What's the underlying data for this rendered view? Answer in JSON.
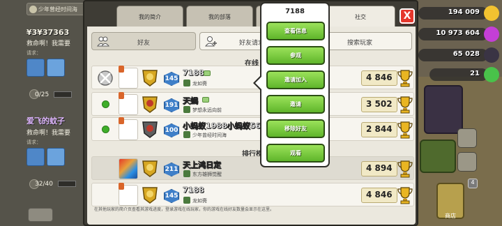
{
  "chat": {
    "clan_label": "少年曾经时间海",
    "messages": [
      {
        "name": "¥3¥37363",
        "text": "救命啊！我需要",
        "sub": "请求：",
        "progress": "0/25"
      },
      {
        "name": "爱飞的蚊子",
        "text": "救命啊！我需要",
        "sub": "请求：",
        "progress": "32/40"
      }
    ]
  },
  "resources": {
    "gold": "194 009",
    "elixir": "10 973 604",
    "dark": "65 028",
    "gems": "21"
  },
  "tabs": [
    {
      "label": "我的简介"
    },
    {
      "label": "我的部落"
    },
    {
      "label": ""
    },
    {
      "label": "社交"
    }
  ],
  "close_label": "X",
  "subtabs": {
    "friends": "好友",
    "add_friend": "好友请求",
    "search": "搜索玩家"
  },
  "sections": {
    "online": "在线",
    "leaderboard": "排行榜"
  },
  "friends": [
    {
      "name": "7188",
      "clan": "龙如斋",
      "level": "145",
      "trophies": "4 846",
      "league_rank": "1"
    },
    {
      "name": "天蝎",
      "clan": "梦想永远向前",
      "level": "191",
      "trophies": "3 502",
      "league_rank": "2"
    },
    {
      "name": "小蚂蚁1988小蚂蚁5612",
      "clan": "少年曾经时间海",
      "level": "100",
      "trophies": "2 844",
      "league_rank": "2"
    },
    {
      "name": "天上鸿日定",
      "clan": "东方雄狮觉醒",
      "level": "211",
      "trophies": "4 894",
      "league_rank": ""
    },
    {
      "name": "7188",
      "clan": "龙如斋",
      "level": "145",
      "trophies": "4 846",
      "league_rank": "1"
    }
  ],
  "footnote": "在其他玩家的简介页查看其游戏进度，登录游戏在线玩家，你的游戏在线好友数量会显示在这里。",
  "popup": {
    "title": "7188",
    "items": [
      "查看信息",
      "参观",
      "邀请加入",
      "邀请",
      "移除好友",
      "观看"
    ]
  },
  "shop": {
    "label": "商店",
    "badge": "4"
  },
  "colors": {
    "menu_green": "#6fc234",
    "close_red": "#e5372c",
    "online_green": "#3fae2a",
    "level_blue": "#3f7fc8"
  }
}
